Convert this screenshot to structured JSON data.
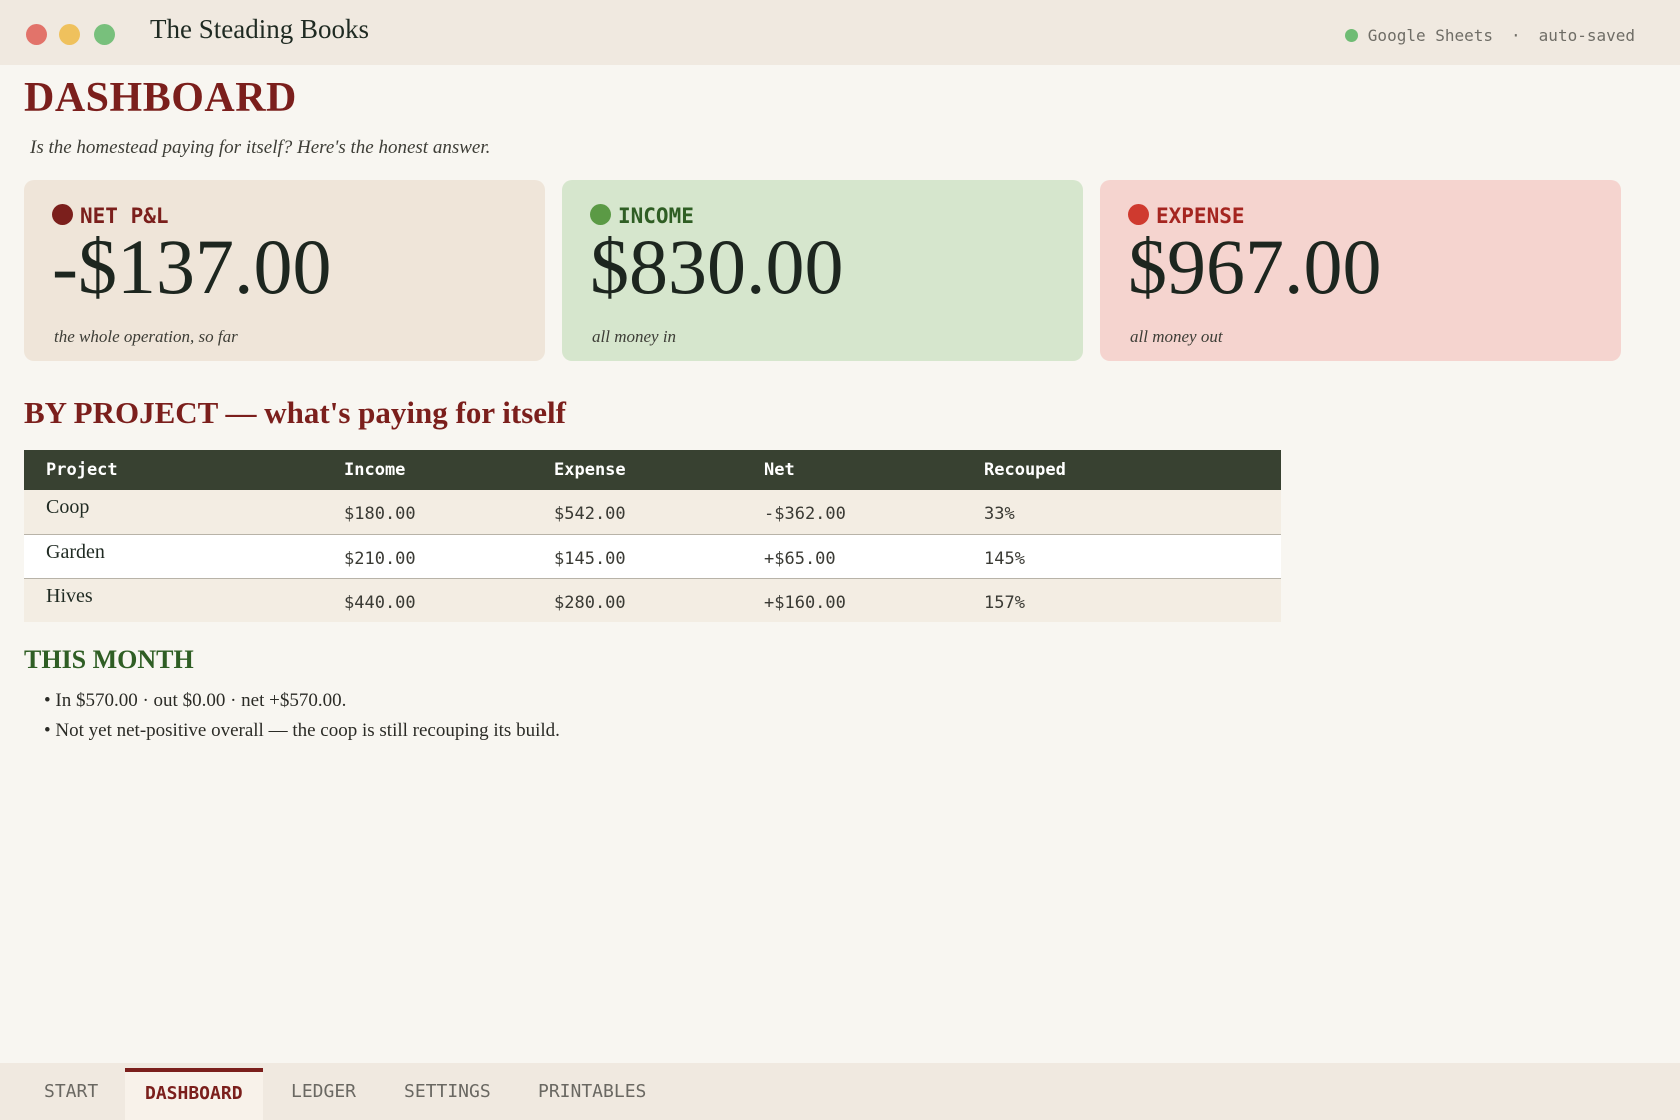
{
  "window": {
    "title": "The Steading Books",
    "sync_service": "Google Sheets",
    "sync_separator": "·",
    "sync_status": "auto-saved",
    "sync_color": "#6fbc74"
  },
  "page": {
    "title": "DASHBOARD",
    "subtitle": "Is the homestead paying for itself? Here's the honest answer."
  },
  "cards": [
    {
      "label": "NET P&L",
      "value": "-$137.00",
      "note": "the whole operation, so far",
      "dot_color": "#7b1f1c",
      "label_color": "#7b1f1c",
      "bg": "#efe5d9"
    },
    {
      "label": "INCOME",
      "value": "$830.00",
      "note": "all money in",
      "dot_color": "#5b9a45",
      "label_color": "#2f5e24",
      "bg": "#d6e6cd"
    },
    {
      "label": "EXPENSE",
      "value": "$967.00",
      "note": "all money out",
      "dot_color": "#cf3a2f",
      "label_color": "#a52520",
      "bg": "#f5d4cf"
    }
  ],
  "by_project": {
    "heading": "BY PROJECT — what's paying for itself",
    "columns": [
      "Project",
      "Income",
      "Expense",
      "Net",
      "Recouped"
    ],
    "rows": [
      [
        "Coop",
        "$180.00",
        "$542.00",
        "-$362.00",
        "33%"
      ],
      [
        "Garden",
        "$210.00",
        "$145.00",
        "+$65.00",
        "145%"
      ],
      [
        "Hives",
        "$440.00",
        "$280.00",
        "+$160.00",
        "157%"
      ]
    ]
  },
  "this_month": {
    "heading": "THIS MONTH",
    "lines": [
      "In $570.00 · out $0.00 · net +$570.00.",
      "Not yet net-positive overall — the coop is still recouping its build."
    ]
  },
  "tabs": [
    {
      "label": "START",
      "active": false
    },
    {
      "label": "DASHBOARD",
      "active": true
    },
    {
      "label": "LEDGER",
      "active": false
    },
    {
      "label": "SETTINGS",
      "active": false
    },
    {
      "label": "PRINTABLES",
      "active": false
    }
  ]
}
